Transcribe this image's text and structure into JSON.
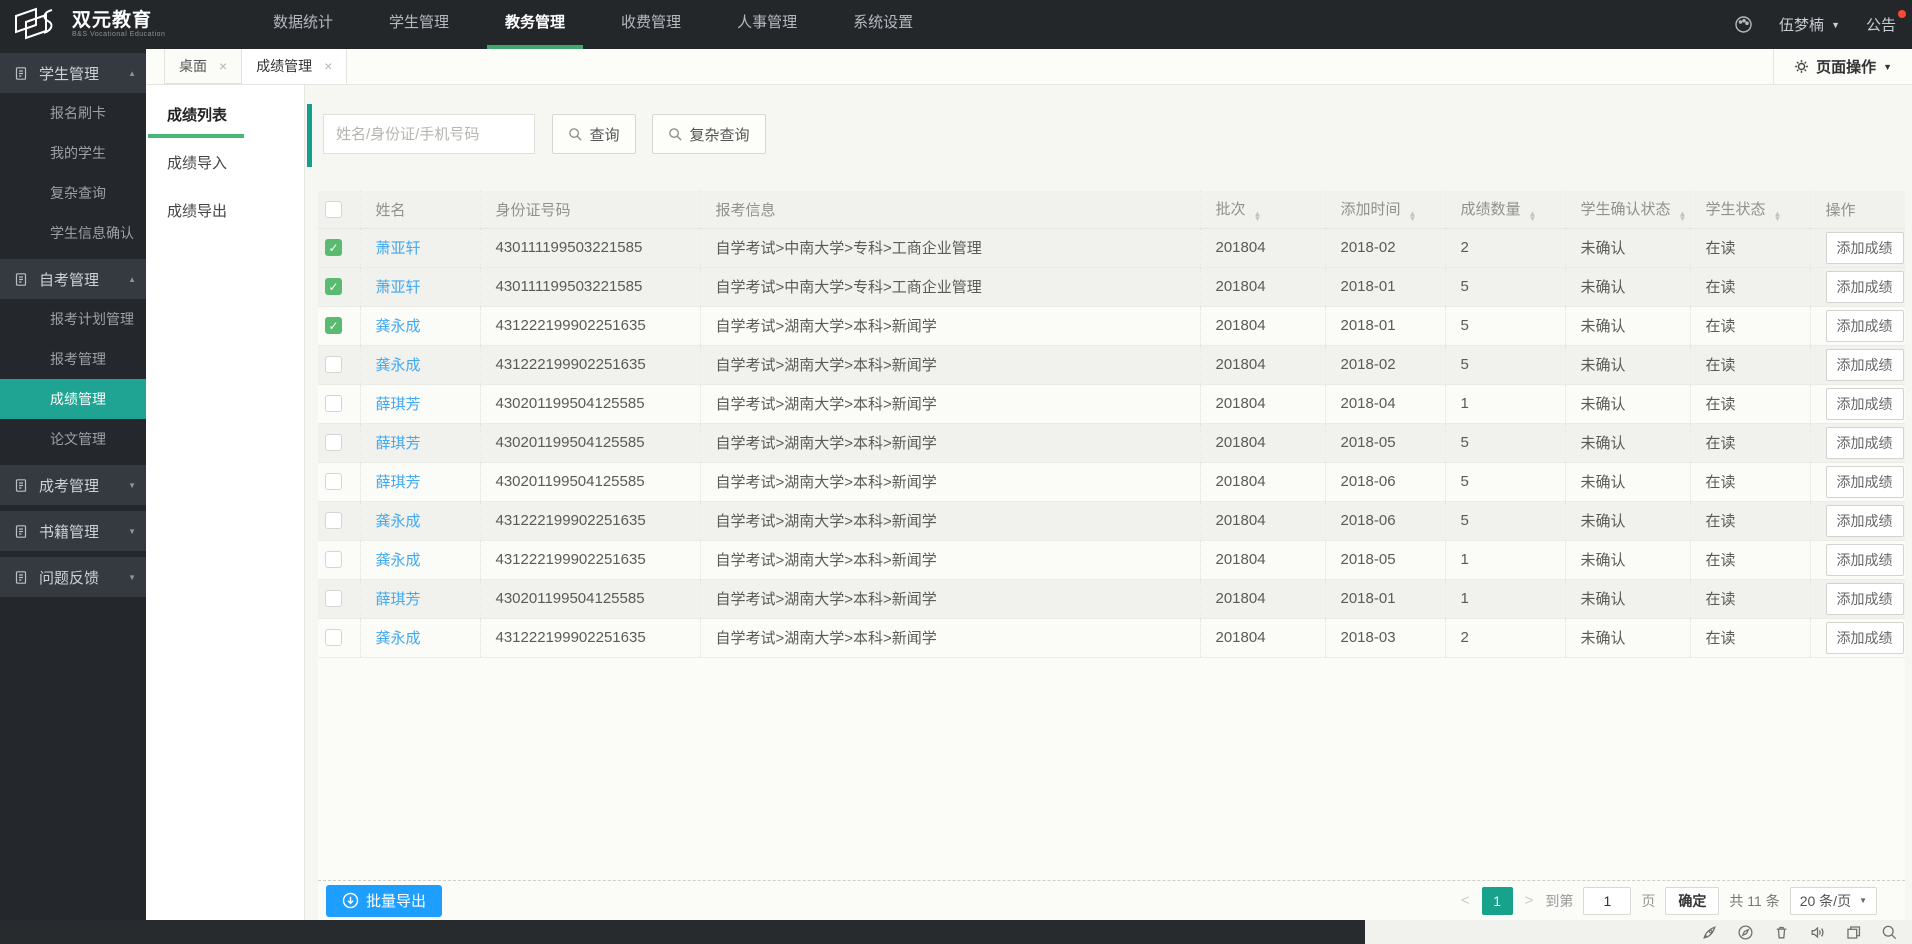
{
  "brand": {
    "title": "双元教育",
    "subtitle": "B&S Vocational Education"
  },
  "navbar": {
    "items": [
      {
        "label": "数据统计",
        "active": false
      },
      {
        "label": "学生管理",
        "active": false
      },
      {
        "label": "教务管理",
        "active": true
      },
      {
        "label": "收费管理",
        "active": false
      },
      {
        "label": "人事管理",
        "active": false
      },
      {
        "label": "系统设置",
        "active": false
      }
    ],
    "user": "伍梦楠",
    "notice": "公告"
  },
  "sidebar": {
    "groups": [
      {
        "label": "学生管理",
        "expanded": true,
        "items": [
          {
            "label": "报名刷卡"
          },
          {
            "label": "我的学生"
          },
          {
            "label": "复杂查询"
          },
          {
            "label": "学生信息确认"
          }
        ]
      },
      {
        "label": "自考管理",
        "expanded": true,
        "items": [
          {
            "label": "报考计划管理"
          },
          {
            "label": "报考管理"
          },
          {
            "label": "成绩管理",
            "active": true
          },
          {
            "label": "论文管理"
          }
        ]
      },
      {
        "label": "成考管理",
        "expanded": false,
        "items": []
      },
      {
        "label": "书籍管理",
        "expanded": false,
        "items": []
      },
      {
        "label": "问题反馈",
        "expanded": false,
        "items": []
      }
    ]
  },
  "tabs": [
    {
      "label": "桌面",
      "active": false
    },
    {
      "label": "成绩管理",
      "active": true
    }
  ],
  "page_actions": "页面操作",
  "submenu": [
    {
      "label": "成绩列表",
      "active": true
    },
    {
      "label": "成绩导入",
      "active": false
    },
    {
      "label": "成绩导出",
      "active": false
    }
  ],
  "search": {
    "placeholder": "姓名/身份证/手机号码",
    "query_label": "查询",
    "complex_query_label": "复杂查询"
  },
  "table": {
    "headers": [
      {
        "label": "",
        "sortable": false
      },
      {
        "label": "姓名",
        "sortable": false
      },
      {
        "label": "身份证号码",
        "sortable": false
      },
      {
        "label": "报考信息",
        "sortable": false
      },
      {
        "label": "批次",
        "sortable": true
      },
      {
        "label": "添加时间",
        "sortable": true
      },
      {
        "label": "成绩数量",
        "sortable": true
      },
      {
        "label": "学生确认状态",
        "sortable": true
      },
      {
        "label": "学生状态",
        "sortable": true
      },
      {
        "label": "操作",
        "sortable": false
      }
    ],
    "action_label": "添加成绩",
    "rows": [
      {
        "checked": true,
        "shaded": true,
        "name": "萧亚轩",
        "id": "430111199503221585",
        "info": "自学考试>中南大学>专科>工商企业管理",
        "batch": "201804",
        "added": "2018-02",
        "count": "2",
        "confirm": "未确认",
        "status": "在读"
      },
      {
        "checked": true,
        "shaded": true,
        "name": "萧亚轩",
        "id": "430111199503221585",
        "info": "自学考试>中南大学>专科>工商企业管理",
        "batch": "201804",
        "added": "2018-01",
        "count": "5",
        "confirm": "未确认",
        "status": "在读"
      },
      {
        "checked": true,
        "shaded": false,
        "name": "龚永成",
        "id": "431222199902251635",
        "info": "自学考试>湖南大学>本科>新闻学",
        "batch": "201804",
        "added": "2018-01",
        "count": "5",
        "confirm": "未确认",
        "status": "在读"
      },
      {
        "checked": false,
        "shaded": true,
        "name": "龚永成",
        "id": "431222199902251635",
        "info": "自学考试>湖南大学>本科>新闻学",
        "batch": "201804",
        "added": "2018-02",
        "count": "5",
        "confirm": "未确认",
        "status": "在读"
      },
      {
        "checked": false,
        "shaded": false,
        "name": "薛琪芳",
        "id": "430201199504125585",
        "info": "自学考试>湖南大学>本科>新闻学",
        "batch": "201804",
        "added": "2018-04",
        "count": "1",
        "confirm": "未确认",
        "status": "在读"
      },
      {
        "checked": false,
        "shaded": true,
        "name": "薛琪芳",
        "id": "430201199504125585",
        "info": "自学考试>湖南大学>本科>新闻学",
        "batch": "201804",
        "added": "2018-05",
        "count": "5",
        "confirm": "未确认",
        "status": "在读"
      },
      {
        "checked": false,
        "shaded": false,
        "name": "薛琪芳",
        "id": "430201199504125585",
        "info": "自学考试>湖南大学>本科>新闻学",
        "batch": "201804",
        "added": "2018-06",
        "count": "5",
        "confirm": "未确认",
        "status": "在读"
      },
      {
        "checked": false,
        "shaded": true,
        "name": "龚永成",
        "id": "431222199902251635",
        "info": "自学考试>湖南大学>本科>新闻学",
        "batch": "201804",
        "added": "2018-06",
        "count": "5",
        "confirm": "未确认",
        "status": "在读"
      },
      {
        "checked": false,
        "shaded": false,
        "name": "龚永成",
        "id": "431222199902251635",
        "info": "自学考试>湖南大学>本科>新闻学",
        "batch": "201804",
        "added": "2018-05",
        "count": "1",
        "confirm": "未确认",
        "status": "在读"
      },
      {
        "checked": false,
        "shaded": true,
        "name": "薛琪芳",
        "id": "430201199504125585",
        "info": "自学考试>湖南大学>本科>新闻学",
        "batch": "201804",
        "added": "2018-01",
        "count": "1",
        "confirm": "未确认",
        "status": "在读"
      },
      {
        "checked": false,
        "shaded": false,
        "name": "龚永成",
        "id": "431222199902251635",
        "info": "自学考试>湖南大学>本科>新闻学",
        "batch": "201804",
        "added": "2018-03",
        "count": "2",
        "confirm": "未确认",
        "status": "在读"
      }
    ]
  },
  "footer": {
    "batch_export_label": "批量导出",
    "pagination": {
      "prev": "<",
      "page": "1",
      "next": ">",
      "goto_label": "到第",
      "page_input": "1",
      "page_unit": "页",
      "confirm_label": "确定",
      "total_label": "共 11 条",
      "page_size": "20 条/页"
    }
  },
  "statusbar": {
    "icons": [
      "rocket",
      "compass",
      "trash",
      "speaker",
      "windows",
      "search"
    ]
  },
  "colors": {
    "nav_active_underline": "#3fa86e",
    "sidebar_active": "#1fa392",
    "accent_bar": "#12a08c",
    "link_blue": "#41a9f0",
    "primary_button": "#1e9fff",
    "checkbox_green": "#5abb70",
    "notice_dot": "#ff4736",
    "page_active": "#17a28b"
  }
}
